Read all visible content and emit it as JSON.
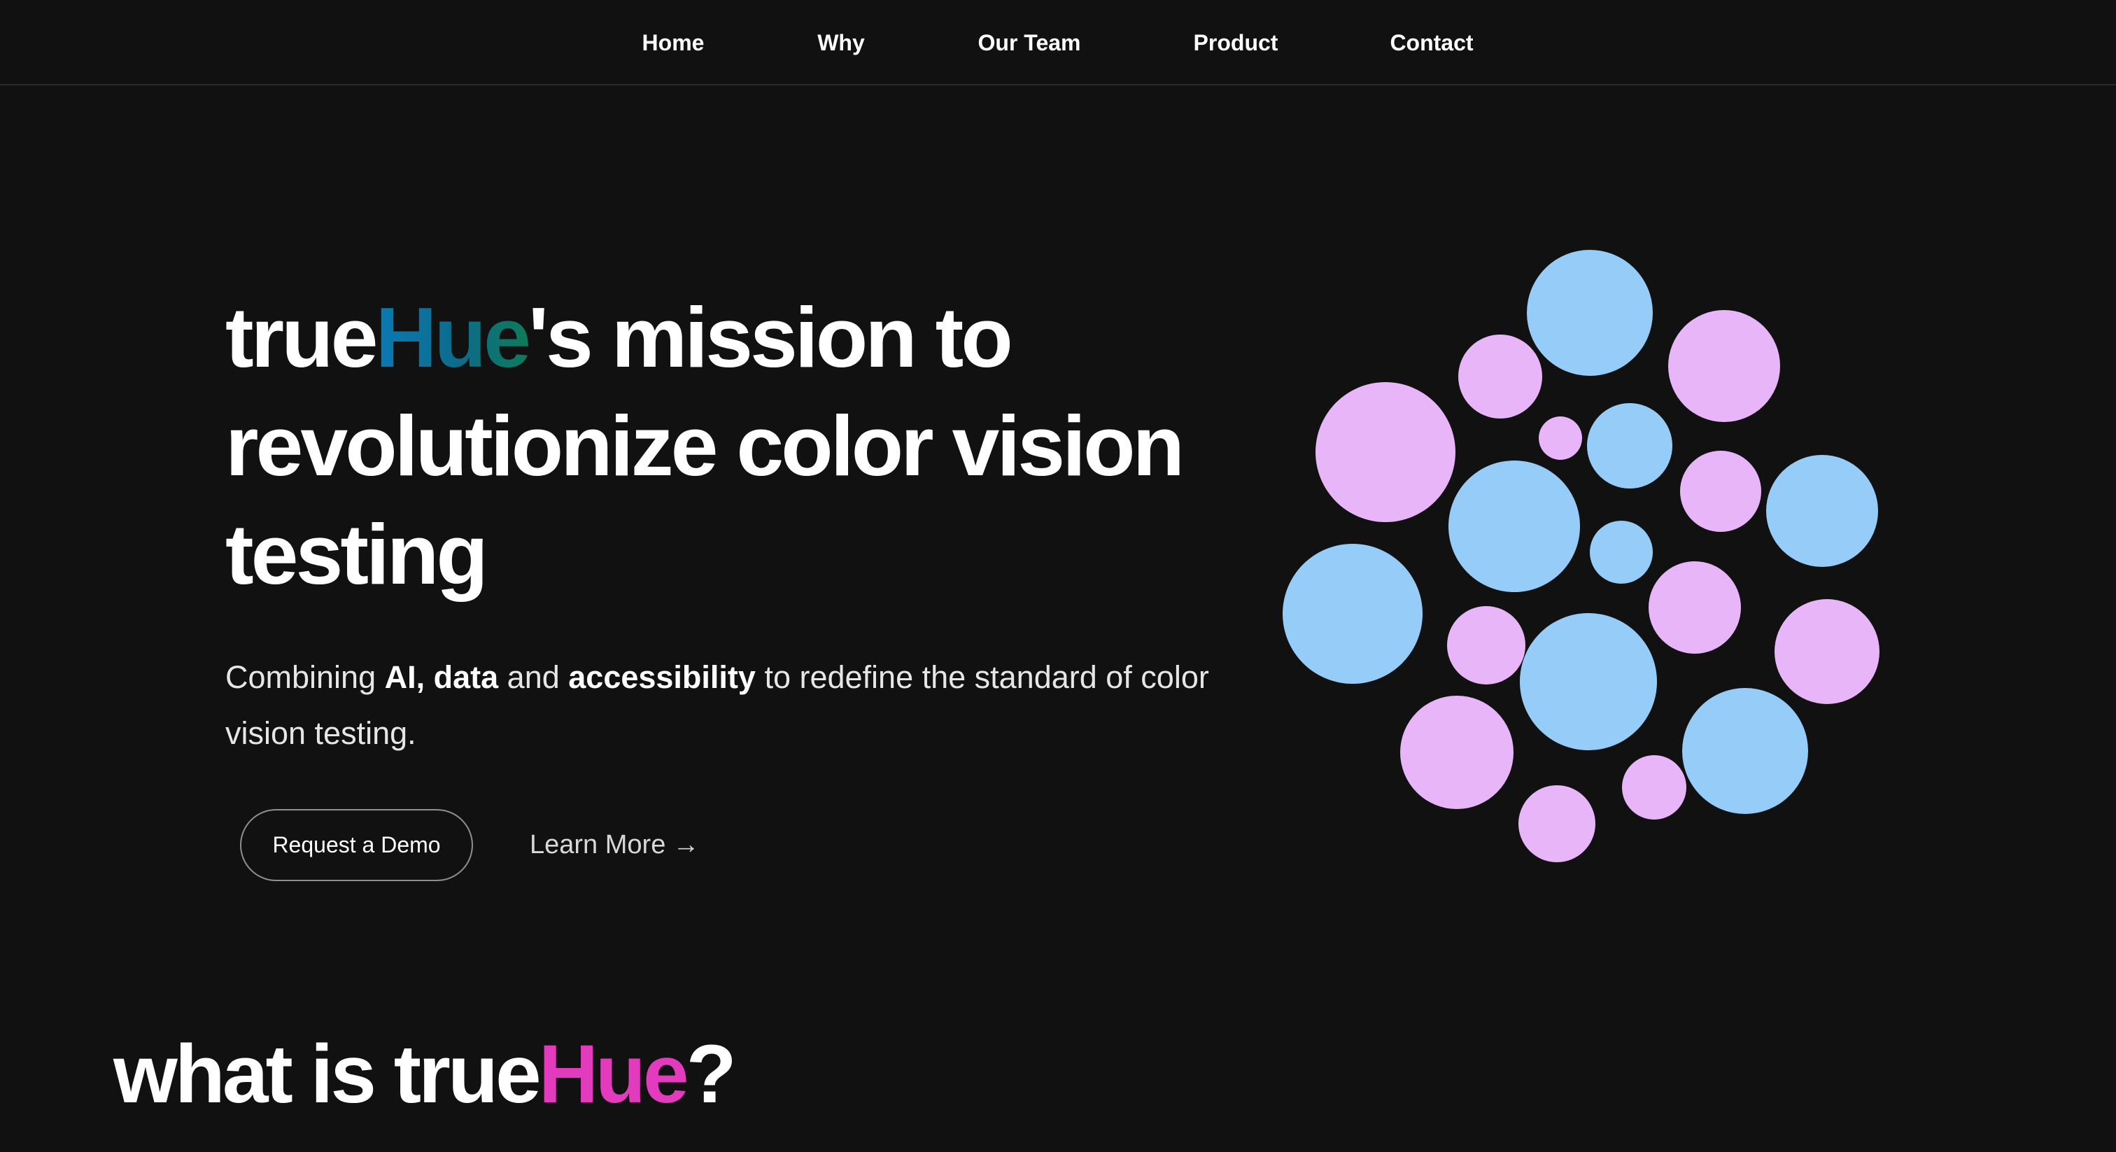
{
  "nav": {
    "items": [
      "Home",
      "Why",
      "Our Team",
      "Product",
      "Contact"
    ]
  },
  "hero": {
    "title_brand_true": "true",
    "title_brand_hue": "Hue",
    "title_rest": "'s mission to revolutionize color vision testing",
    "subtitle_parts": {
      "p1": "Combining ",
      "b1": "AI, data",
      "p2": " and ",
      "b2": "accessibility",
      "p3": " to redefine the standard of color vision testing."
    },
    "primary_button": "Request a Demo",
    "secondary_button": "Learn More",
    "secondary_arrow": "→"
  },
  "section": {
    "title_prefix": "what is true",
    "title_brand": "Hue",
    "title_suffix": "?"
  },
  "colors": {
    "background": "#111111",
    "brand_hue_gradient_start": "#0b79b3",
    "brand_hue_gradient_end": "#0e7a5a",
    "brand_hue_pink": "#e33bbd",
    "dot_blue": "#96cdf8",
    "dot_pink": "#e8b5f8"
  },
  "icons": {
    "learn_more": "arrow-right-icon",
    "hero_graphic": "color-dot-cluster-icon"
  }
}
